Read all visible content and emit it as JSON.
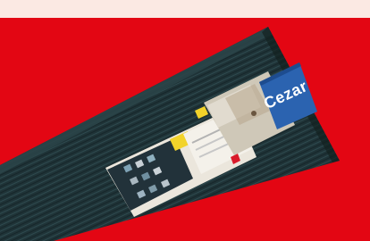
{
  "photo": {
    "background_color": "#fbe9e3",
    "backdrop_color": "#e30613",
    "product": {
      "board_color": "#1f3337",
      "brand_logo": "Cezar",
      "brand_color": "#2b63b0"
    }
  }
}
